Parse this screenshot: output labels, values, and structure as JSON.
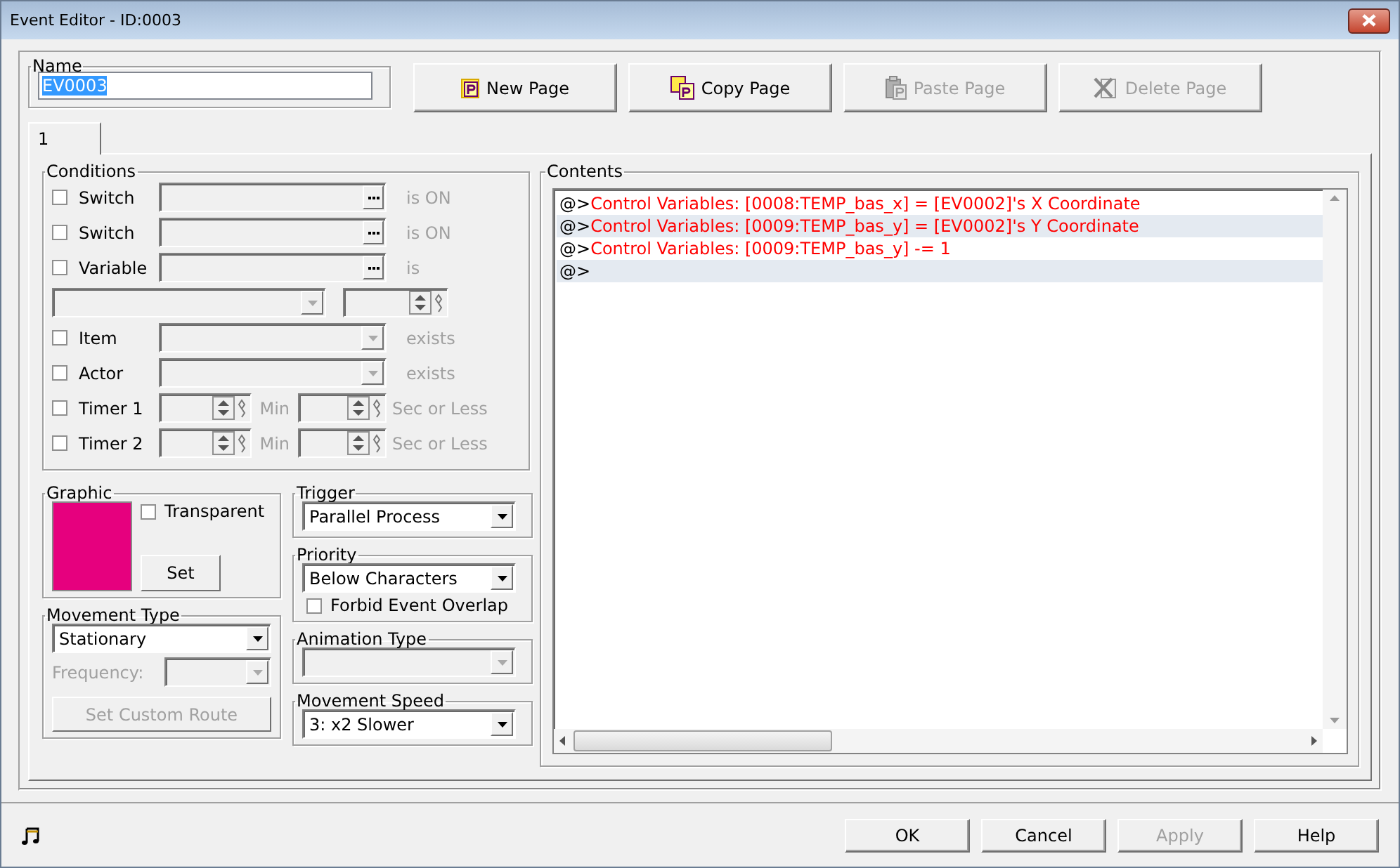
{
  "window": {
    "title": "Event Editor - ID:0003"
  },
  "name_group": {
    "label": "Name",
    "value": "EV0003"
  },
  "page_buttons": [
    {
      "label": "New Page",
      "disabled": false
    },
    {
      "label": "Copy Page",
      "disabled": false
    },
    {
      "label": "Paste Page",
      "disabled": true
    },
    {
      "label": "Delete Page",
      "disabled": true
    }
  ],
  "tabs": [
    {
      "label": "1",
      "selected": true
    }
  ],
  "conditions": {
    "title": "Conditions",
    "rows": [
      {
        "kind": "picker",
        "label": "Switch",
        "checked": false,
        "suffix": "is ON"
      },
      {
        "kind": "picker",
        "label": "Switch",
        "checked": false,
        "suffix": "is ON"
      },
      {
        "kind": "picker",
        "label": "Variable",
        "checked": false,
        "suffix": "is"
      },
      {
        "kind": "compare",
        "checked": false
      },
      {
        "kind": "combo",
        "label": "Item",
        "checked": false,
        "suffix": "exists"
      },
      {
        "kind": "combo",
        "label": "Actor",
        "checked": false,
        "suffix": "exists"
      },
      {
        "kind": "timer",
        "label": "Timer 1",
        "checked": false,
        "unit": "Min",
        "suffix": "Sec or Less"
      },
      {
        "kind": "timer",
        "label": "Timer 2",
        "checked": false,
        "unit": "Min",
        "suffix": "Sec or Less"
      }
    ]
  },
  "graphic": {
    "title": "Graphic",
    "color": "#e6007e",
    "transparent": {
      "label": "Transparent",
      "checked": false
    },
    "set_button": "Set"
  },
  "movement_type": {
    "title": "Movement Type",
    "value": "Stationary",
    "frequency_label": "Frequency:",
    "custom_route_button": "Set Custom Route",
    "disabled": true
  },
  "trigger": {
    "title": "Trigger",
    "value": "Parallel Process"
  },
  "priority": {
    "title": "Priority",
    "value": "Below Characters",
    "forbid_overlap": {
      "label": "Forbid Event Overlap",
      "checked": false
    }
  },
  "animation_type": {
    "title": "Animation Type",
    "disabled": true
  },
  "movement_speed": {
    "title": "Movement Speed",
    "value": "3: x2 Slower"
  },
  "contents": {
    "title": "Contents",
    "lines": [
      {
        "prefix": "@>",
        "text": "Control Variables: [0008:TEMP_bas_x] = [EV0002]'s X Coordinate"
      },
      {
        "prefix": "@>",
        "text": "Control Variables: [0009:TEMP_bas_y] = [EV0002]'s Y Coordinate"
      },
      {
        "prefix": "@>",
        "text": "Control Variables: [0009:TEMP_bas_y] -= 1"
      },
      {
        "prefix": "@>"
      }
    ]
  },
  "footer_buttons": [
    {
      "label": "OK",
      "disabled": false
    },
    {
      "label": "Cancel",
      "disabled": false
    },
    {
      "label": "Apply",
      "disabled": true
    },
    {
      "label": "Help",
      "disabled": false
    }
  ]
}
